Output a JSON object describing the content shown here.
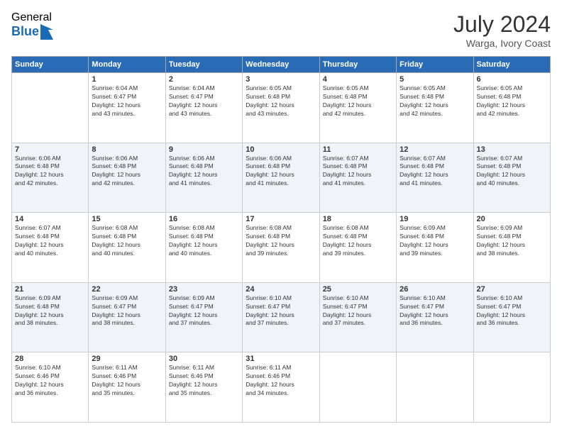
{
  "logo": {
    "general": "General",
    "blue": "Blue"
  },
  "header": {
    "month": "July 2024",
    "location": "Warga, Ivory Coast"
  },
  "days_of_week": [
    "Sunday",
    "Monday",
    "Tuesday",
    "Wednesday",
    "Thursday",
    "Friday",
    "Saturday"
  ],
  "weeks": [
    [
      {
        "day": "",
        "info": ""
      },
      {
        "day": "1",
        "info": "Sunrise: 6:04 AM\nSunset: 6:47 PM\nDaylight: 12 hours\nand 43 minutes."
      },
      {
        "day": "2",
        "info": "Sunrise: 6:04 AM\nSunset: 6:47 PM\nDaylight: 12 hours\nand 43 minutes."
      },
      {
        "day": "3",
        "info": "Sunrise: 6:05 AM\nSunset: 6:48 PM\nDaylight: 12 hours\nand 43 minutes."
      },
      {
        "day": "4",
        "info": "Sunrise: 6:05 AM\nSunset: 6:48 PM\nDaylight: 12 hours\nand 42 minutes."
      },
      {
        "day": "5",
        "info": "Sunrise: 6:05 AM\nSunset: 6:48 PM\nDaylight: 12 hours\nand 42 minutes."
      },
      {
        "day": "6",
        "info": "Sunrise: 6:05 AM\nSunset: 6:48 PM\nDaylight: 12 hours\nand 42 minutes."
      }
    ],
    [
      {
        "day": "7",
        "info": "Sunrise: 6:06 AM\nSunset: 6:48 PM\nDaylight: 12 hours\nand 42 minutes."
      },
      {
        "day": "8",
        "info": "Sunrise: 6:06 AM\nSunset: 6:48 PM\nDaylight: 12 hours\nand 42 minutes."
      },
      {
        "day": "9",
        "info": "Sunrise: 6:06 AM\nSunset: 6:48 PM\nDaylight: 12 hours\nand 41 minutes."
      },
      {
        "day": "10",
        "info": "Sunrise: 6:06 AM\nSunset: 6:48 PM\nDaylight: 12 hours\nand 41 minutes."
      },
      {
        "day": "11",
        "info": "Sunrise: 6:07 AM\nSunset: 6:48 PM\nDaylight: 12 hours\nand 41 minutes."
      },
      {
        "day": "12",
        "info": "Sunrise: 6:07 AM\nSunset: 6:48 PM\nDaylight: 12 hours\nand 41 minutes."
      },
      {
        "day": "13",
        "info": "Sunrise: 6:07 AM\nSunset: 6:48 PM\nDaylight: 12 hours\nand 40 minutes."
      }
    ],
    [
      {
        "day": "14",
        "info": "Sunrise: 6:07 AM\nSunset: 6:48 PM\nDaylight: 12 hours\nand 40 minutes."
      },
      {
        "day": "15",
        "info": "Sunrise: 6:08 AM\nSunset: 6:48 PM\nDaylight: 12 hours\nand 40 minutes."
      },
      {
        "day": "16",
        "info": "Sunrise: 6:08 AM\nSunset: 6:48 PM\nDaylight: 12 hours\nand 40 minutes."
      },
      {
        "day": "17",
        "info": "Sunrise: 6:08 AM\nSunset: 6:48 PM\nDaylight: 12 hours\nand 39 minutes."
      },
      {
        "day": "18",
        "info": "Sunrise: 6:08 AM\nSunset: 6:48 PM\nDaylight: 12 hours\nand 39 minutes."
      },
      {
        "day": "19",
        "info": "Sunrise: 6:09 AM\nSunset: 6:48 PM\nDaylight: 12 hours\nand 39 minutes."
      },
      {
        "day": "20",
        "info": "Sunrise: 6:09 AM\nSunset: 6:48 PM\nDaylight: 12 hours\nand 38 minutes."
      }
    ],
    [
      {
        "day": "21",
        "info": "Sunrise: 6:09 AM\nSunset: 6:48 PM\nDaylight: 12 hours\nand 38 minutes."
      },
      {
        "day": "22",
        "info": "Sunrise: 6:09 AM\nSunset: 6:47 PM\nDaylight: 12 hours\nand 38 minutes."
      },
      {
        "day": "23",
        "info": "Sunrise: 6:09 AM\nSunset: 6:47 PM\nDaylight: 12 hours\nand 37 minutes."
      },
      {
        "day": "24",
        "info": "Sunrise: 6:10 AM\nSunset: 6:47 PM\nDaylight: 12 hours\nand 37 minutes."
      },
      {
        "day": "25",
        "info": "Sunrise: 6:10 AM\nSunset: 6:47 PM\nDaylight: 12 hours\nand 37 minutes."
      },
      {
        "day": "26",
        "info": "Sunrise: 6:10 AM\nSunset: 6:47 PM\nDaylight: 12 hours\nand 36 minutes."
      },
      {
        "day": "27",
        "info": "Sunrise: 6:10 AM\nSunset: 6:47 PM\nDaylight: 12 hours\nand 36 minutes."
      }
    ],
    [
      {
        "day": "28",
        "info": "Sunrise: 6:10 AM\nSunset: 6:46 PM\nDaylight: 12 hours\nand 36 minutes."
      },
      {
        "day": "29",
        "info": "Sunrise: 6:11 AM\nSunset: 6:46 PM\nDaylight: 12 hours\nand 35 minutes."
      },
      {
        "day": "30",
        "info": "Sunrise: 6:11 AM\nSunset: 6:46 PM\nDaylight: 12 hours\nand 35 minutes."
      },
      {
        "day": "31",
        "info": "Sunrise: 6:11 AM\nSunset: 6:46 PM\nDaylight: 12 hours\nand 34 minutes."
      },
      {
        "day": "",
        "info": ""
      },
      {
        "day": "",
        "info": ""
      },
      {
        "day": "",
        "info": ""
      }
    ]
  ]
}
